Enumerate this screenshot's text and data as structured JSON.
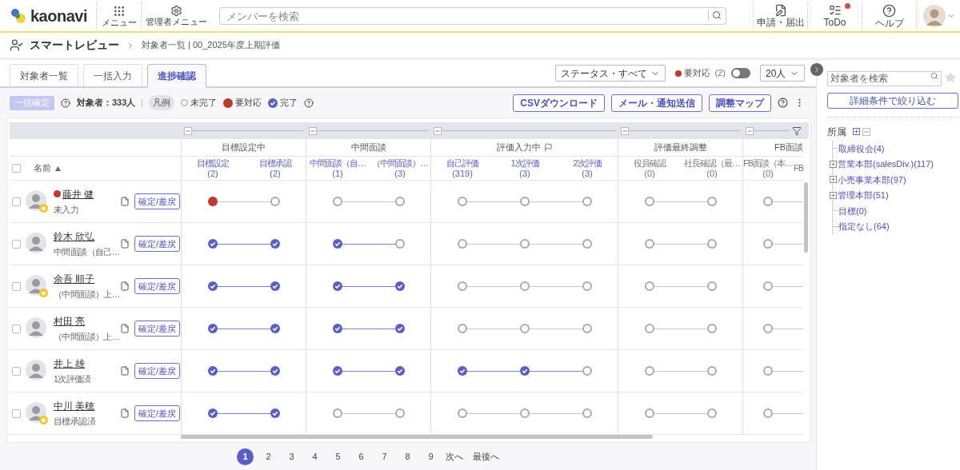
{
  "header": {
    "logo": "kaonavi",
    "nav": [
      {
        "label": "メニュー",
        "kind": "grid"
      },
      {
        "label": "管理者メニュー",
        "kind": "gear"
      }
    ],
    "search": {
      "placeholder": "メンバーを検索"
    },
    "actions": [
      {
        "label": "申請・届出",
        "kind": "request",
        "badge": false
      },
      {
        "label": "ToDo",
        "kind": "todo",
        "badge": true
      },
      {
        "label": "ヘルプ",
        "kind": "help",
        "badge": false
      }
    ]
  },
  "breadcrumb": {
    "title": "スマートレビュー",
    "path": "対象者一覧 | 00_2025年度上期評価"
  },
  "tabs": [
    {
      "label": "対象者一覧",
      "selected": false
    },
    {
      "label": "一括入力",
      "selected": false
    },
    {
      "label": "進捗確認",
      "selected": true
    }
  ],
  "filters": {
    "status": "ステータス・すべて",
    "needs_action": {
      "label": "要対応",
      "count": "(2)",
      "on": false
    },
    "per_page": "20人"
  },
  "toolbar": {
    "bulk_confirm": {
      "label": "一括確定",
      "disabled": true
    },
    "target_count": "対象者：333人",
    "legend_label": "凡例",
    "legend": [
      {
        "kind": "todo",
        "label": "未完了"
      },
      {
        "kind": "alert",
        "label": "要対応"
      },
      {
        "kind": "done",
        "label": "完了"
      }
    ],
    "buttons": [
      "CSVダウンロード",
      "メール・通知送信",
      "調整マップ"
    ]
  },
  "table": {
    "name_header": "名前",
    "select_all_checked": false,
    "groups": [
      {
        "title": "目標設定中",
        "flag": false,
        "steps": [
          {
            "label": "目標設定",
            "count": "(2)",
            "link": true
          },
          {
            "label": "目標承認",
            "count": "(2)",
            "link": true
          }
        ]
      },
      {
        "title": "中間面談",
        "flag": false,
        "steps": [
          {
            "label": "中間面談（自…",
            "count": "(1)",
            "link": true
          },
          {
            "label": "（中間面談）…",
            "count": "(3)",
            "link": true
          }
        ]
      },
      {
        "title": "評価入力中",
        "flag": true,
        "steps": [
          {
            "label": "自己評価",
            "count": "(319)",
            "link": true
          },
          {
            "label": "1次評価",
            "count": "(3)",
            "link": true
          },
          {
            "label": "2次評価",
            "count": "(3)",
            "link": true
          }
        ]
      },
      {
        "title": "評価最終調整",
        "flag": false,
        "steps": [
          {
            "label": "役員確認",
            "count": "(0)",
            "link": false
          },
          {
            "label": "社長確認（最…",
            "count": "(0)",
            "link": false
          }
        ]
      },
      {
        "title": "FB面談",
        "flag": false,
        "steps": [
          {
            "label": "FB面談（本…",
            "count": "(0)",
            "link": false
          },
          {
            "label": "FB",
            "link": false
          }
        ]
      }
    ],
    "rows": [
      {
        "name": "藤井 健",
        "status": "未入力",
        "alert": true,
        "starred": true,
        "checked": false,
        "button": "確定/差戻",
        "progress": [
          [
            {
              "done": false,
              "alert": true
            },
            {
              "done": false,
              "alert": false
            }
          ],
          [
            {
              "done": false,
              "alert": false
            },
            {
              "done": false,
              "alert": false
            }
          ],
          [
            {
              "done": false,
              "alert": false
            },
            {
              "done": false,
              "alert": false
            },
            {
              "done": false,
              "alert": false
            }
          ],
          [
            {
              "done": false,
              "alert": false
            },
            {
              "done": false,
              "alert": false
            }
          ],
          [
            {
              "done": false,
              "alert": false
            }
          ]
        ]
      },
      {
        "name": "鈴木 欣弘",
        "status": "中間面談（自己…",
        "alert": false,
        "starred": false,
        "checked": false,
        "button": "確定/差戻",
        "progress": [
          [
            {
              "done": true,
              "alert": false
            },
            {
              "done": true,
              "alert": false
            }
          ],
          [
            {
              "done": true,
              "alert": false
            },
            {
              "done": false,
              "alert": false
            }
          ],
          [
            {
              "done": false,
              "alert": false
            },
            {
              "done": false,
              "alert": false
            },
            {
              "done": false,
              "alert": false
            }
          ],
          [
            {
              "done": false,
              "alert": false
            },
            {
              "done": false,
              "alert": false
            }
          ],
          [
            {
              "done": false,
              "alert": false
            }
          ]
        ]
      },
      {
        "name": "余吾 順子",
        "status": "（中間面談）上…",
        "alert": false,
        "starred": true,
        "checked": false,
        "button": "確定/差戻",
        "progress": [
          [
            {
              "done": true,
              "alert": false
            },
            {
              "done": true,
              "alert": false
            }
          ],
          [
            {
              "done": true,
              "alert": false
            },
            {
              "done": true,
              "alert": false
            }
          ],
          [
            {
              "done": false,
              "alert": false
            },
            {
              "done": false,
              "alert": false
            },
            {
              "done": false,
              "alert": false
            }
          ],
          [
            {
              "done": false,
              "alert": false
            },
            {
              "done": false,
              "alert": false
            }
          ],
          [
            {
              "done": false,
              "alert": false
            }
          ]
        ]
      },
      {
        "name": "村田 亮",
        "status": "（中間面談）上…",
        "alert": false,
        "starred": false,
        "checked": false,
        "button": "確定/差戻",
        "progress": [
          [
            {
              "done": true,
              "alert": false
            },
            {
              "done": true,
              "alert": false
            }
          ],
          [
            {
              "done": true,
              "alert": false
            },
            {
              "done": true,
              "alert": false
            }
          ],
          [
            {
              "done": false,
              "alert": false
            },
            {
              "done": false,
              "alert": false
            },
            {
              "done": false,
              "alert": false
            }
          ],
          [
            {
              "done": false,
              "alert": false
            },
            {
              "done": false,
              "alert": false
            }
          ],
          [
            {
              "done": false,
              "alert": false
            }
          ]
        ]
      },
      {
        "name": "井上 雄",
        "status": "1次評価済",
        "alert": false,
        "starred": false,
        "checked": false,
        "button": "確定/差戻",
        "progress": [
          [
            {
              "done": true,
              "alert": false
            },
            {
              "done": true,
              "alert": false
            }
          ],
          [
            {
              "done": true,
              "alert": false
            },
            {
              "done": true,
              "alert": false
            }
          ],
          [
            {
              "done": true,
              "alert": false
            },
            {
              "done": true,
              "alert": false
            },
            {
              "done": false,
              "alert": false
            }
          ],
          [
            {
              "done": false,
              "alert": false
            },
            {
              "done": false,
              "alert": false
            }
          ],
          [
            {
              "done": false,
              "alert": false
            }
          ]
        ]
      },
      {
        "name": "中川 美穂",
        "status": "目標承認済",
        "alert": false,
        "starred": true,
        "checked": false,
        "button": "確定/差戻",
        "progress": [
          [
            {
              "done": true,
              "alert": false
            },
            {
              "done": true,
              "alert": false
            }
          ],
          [
            {
              "done": false,
              "alert": false
            },
            {
              "done": false,
              "alert": false
            }
          ],
          [
            {
              "done": false,
              "alert": false
            },
            {
              "done": false,
              "alert": false
            },
            {
              "done": false,
              "alert": false
            }
          ],
          [
            {
              "done": false,
              "alert": false
            },
            {
              "done": false,
              "alert": false
            }
          ],
          [
            {
              "done": false,
              "alert": false
            }
          ]
        ]
      }
    ]
  },
  "pagination": {
    "pages": [
      {
        "label": "1",
        "selected": true
      },
      {
        "label": "2",
        "selected": false
      },
      {
        "label": "3",
        "selected": false
      },
      {
        "label": "4",
        "selected": false
      },
      {
        "label": "5",
        "selected": false
      },
      {
        "label": "6",
        "selected": false
      },
      {
        "label": "7",
        "selected": false
      },
      {
        "label": "8",
        "selected": false
      },
      {
        "label": "9",
        "selected": false
      }
    ],
    "next": "次へ",
    "last": "最後へ"
  },
  "side": {
    "search_placeholder": "対象者を検索",
    "filter_button": "詳細条件で絞り込む",
    "tree_title": "所属",
    "tree": [
      {
        "label": "取締役会(4)",
        "kind": "leaf"
      },
      {
        "label": "営業本部(salesDiv.)(117)",
        "kind": "branch",
        "expanded": false
      },
      {
        "label": "小売事業本部(97)",
        "kind": "branch",
        "expanded": false
      },
      {
        "label": "管理本部(51)",
        "kind": "branch",
        "expanded": false
      },
      {
        "label": "目標(0)",
        "kind": "leaf"
      },
      {
        "label": "指定なし(64)",
        "kind": "leaf"
      }
    ]
  }
}
